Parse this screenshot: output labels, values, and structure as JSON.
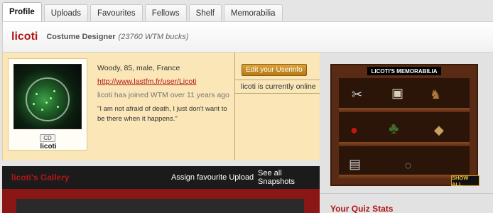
{
  "tabs": [
    {
      "label": "Profile"
    },
    {
      "label": "Uploads"
    },
    {
      "label": "Favourites"
    },
    {
      "label": "Fellows"
    },
    {
      "label": "Shelf"
    },
    {
      "label": "Memorabilia"
    }
  ],
  "header": {
    "username": "licoti",
    "role": "Costume Designer",
    "bucks": "(23760 WTM bucks)"
  },
  "avatar": {
    "badge": "CD",
    "name": "licoti"
  },
  "profile": {
    "bio": "Woody, 85, male, France",
    "link": "http://www.lastfm.fr/user/Licoti",
    "joined": "licoti has joined WTM over 11 years ago",
    "quote": "\"I am not afraid of death, I just don't want to be there when it happens.\""
  },
  "actions": {
    "edit_label": "Edit your Userinfo",
    "status": "licoti is currently online"
  },
  "gallery": {
    "title": "licoti's Gallery",
    "assign_label": "Assign favourite Upload",
    "snapshots_label": "See all Snapshots"
  },
  "memorabilia": {
    "title": "LICOTI'S MEMORABILIA",
    "show_all": "SHOW ALL",
    "items": [
      "razor-icon",
      "picture-frame-icon",
      "deer-figurine-icon",
      "red-hat-icon",
      "gremlin-figurine-icon",
      "ornament-icon",
      "toaster-icon",
      "ring-icon"
    ]
  },
  "quiz": {
    "title": "Your Quiz Stats"
  }
}
